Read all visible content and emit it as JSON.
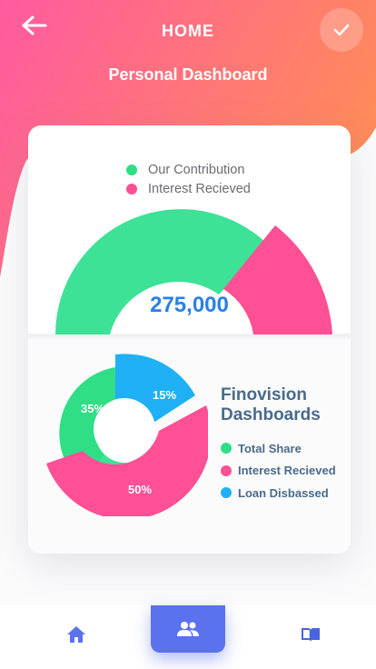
{
  "header": {
    "title": "HOME",
    "subtitle": "Personal Dashboard"
  },
  "icons": {
    "back": "arrow-left-icon",
    "confirm": "check-icon",
    "home": "home-icon",
    "people": "people-icon",
    "book": "book-icon"
  },
  "colors": {
    "green": "#3de296",
    "pink": "#ff4f95",
    "blue": "#1fb0f5",
    "value_blue": "#2a7fe8",
    "nav_active": "#5a72ee",
    "hero_start": "#ff5fa0",
    "hero_end": "#ff8a5c"
  },
  "contribution_card": {
    "legend": [
      {
        "label": "Our Contribution",
        "color": "#2fde85"
      },
      {
        "label": "Interest Recieved",
        "color": "#ff4f95"
      }
    ],
    "total_value": "275,000"
  },
  "finovision": {
    "title": "Finovision Dashboards",
    "legend": [
      {
        "label": "Total Share",
        "color": "#2fde85"
      },
      {
        "label": "Interest Recieved",
        "color": "#ff4f95"
      },
      {
        "label": "Loan Disbassed",
        "color": "#1fb0f5"
      }
    ],
    "slices": [
      {
        "label": "35%",
        "value": 35
      },
      {
        "label": "50%",
        "value": 50
      },
      {
        "label": "15%",
        "value": 15
      }
    ]
  },
  "bottom_nav": {
    "items": [
      {
        "name": "home",
        "active": false
      },
      {
        "name": "people",
        "active": true
      },
      {
        "name": "book",
        "active": false
      }
    ]
  }
}
